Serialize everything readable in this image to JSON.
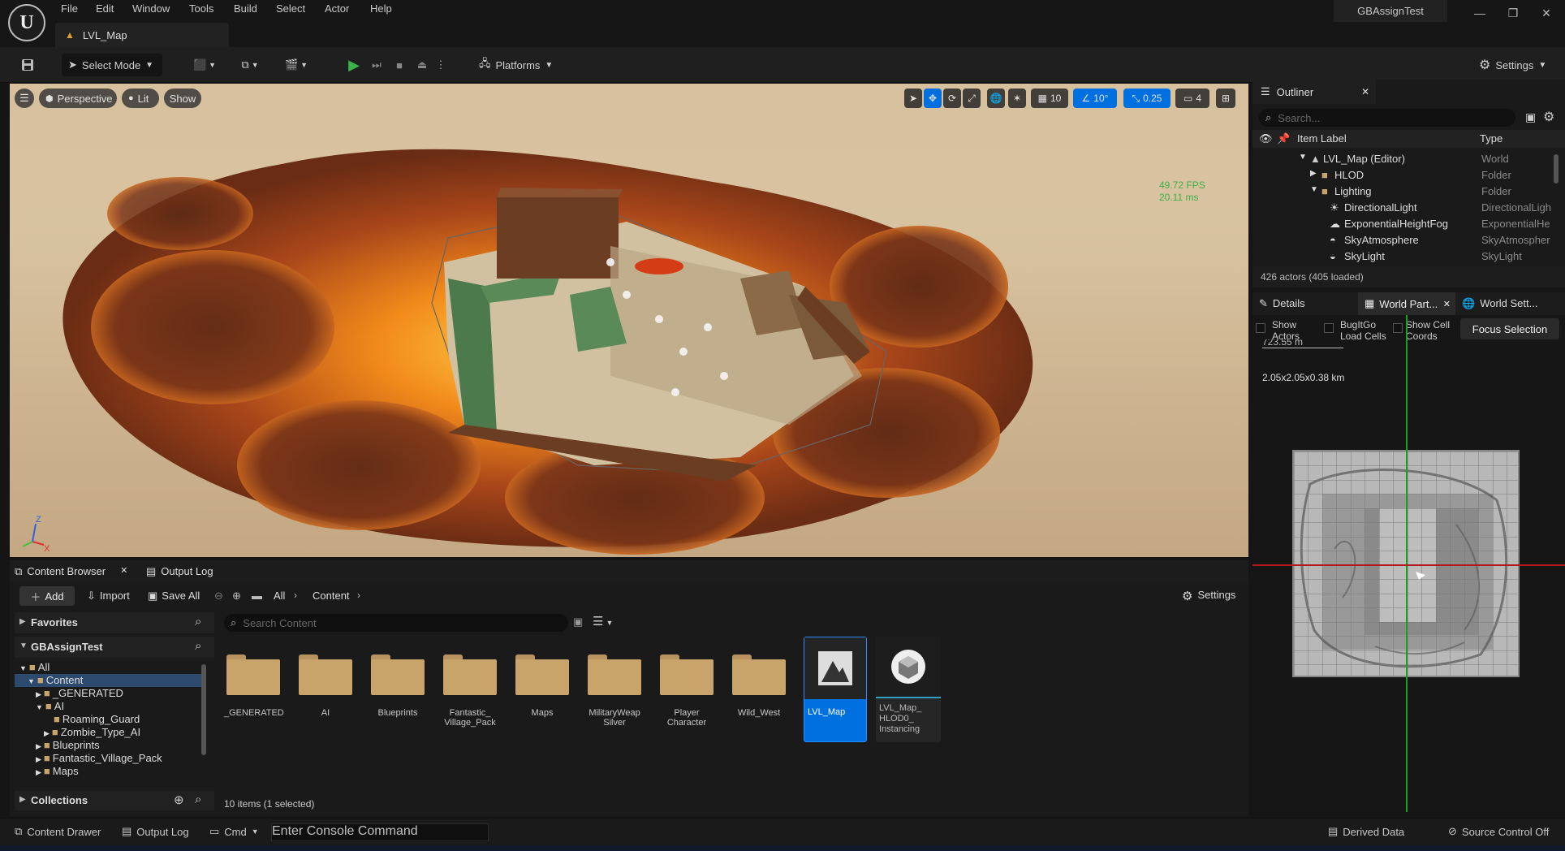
{
  "app": {
    "project_name": "GBAssignTest",
    "document_tab": "LVL_Map"
  },
  "menu": [
    "File",
    "Edit",
    "Window",
    "Tools",
    "Build",
    "Select",
    "Actor",
    "Help"
  ],
  "toolbar": {
    "select_mode": "Select Mode",
    "platforms": "Platforms",
    "settings": "Settings"
  },
  "viewport": {
    "perspective": "Perspective",
    "lit": "Lit",
    "show": "Show",
    "grid_snap": "10",
    "rotation_snap": "10°",
    "scale_snap": "0.25",
    "camera_speed": "4",
    "fps": "49.72 FPS",
    "frame_time": "20.11 ms",
    "axis_x": "X",
    "axis_z": "Z"
  },
  "outliner": {
    "title": "Outliner",
    "search_placeholder": "Search...",
    "col_label": "Item Label",
    "col_type": "Type",
    "rows": [
      {
        "label": "LVL_Map (Editor)",
        "type": "World"
      },
      {
        "label": "HLOD",
        "type": "Folder"
      },
      {
        "label": "Lighting",
        "type": "Folder"
      },
      {
        "label": "DirectionalLight",
        "type": "DirectionalLigh"
      },
      {
        "label": "ExponentialHeightFog",
        "type": "ExponentialHe"
      },
      {
        "label": "SkyAtmosphere",
        "type": "SkyAtmospher"
      },
      {
        "label": "SkyLight",
        "type": "SkyLight"
      }
    ],
    "actor_count": "426 actors (405 loaded)"
  },
  "details": {
    "tabs": [
      "Details",
      "World Part...",
      "World Sett..."
    ],
    "show_actors": "Show Actors",
    "bugitgo": "BugItGo Load Cells",
    "show_cell_coords": "Show Cell Coords",
    "focus_selection": "Focus Selection",
    "scale_label": "723.55 m",
    "world_size": "2.05x2.05x0.38 km"
  },
  "content_browser": {
    "tab": "Content Browser",
    "output_log_tab": "Output Log",
    "add": "Add",
    "import": "Import",
    "save_all": "Save All",
    "breadcrumb": [
      "All",
      "Content"
    ],
    "settings": "Settings",
    "favorites": "Favorites",
    "project_section": "GBAssignTest",
    "collections": "Collections",
    "search_placeholder": "Search Content",
    "tree": [
      "All",
      "Content",
      "_GENERATED",
      "AI",
      "Roaming_Guard",
      "Zombie_Type_AI",
      "Blueprints",
      "Fantastic_Village_Pack",
      "Maps"
    ],
    "assets": [
      {
        "name": "_GENERATED",
        "kind": "folder"
      },
      {
        "name": "AI",
        "kind": "folder"
      },
      {
        "name": "Blueprints",
        "kind": "folder"
      },
      {
        "name": "Fantastic_ Village_Pack",
        "kind": "folder"
      },
      {
        "name": "Maps",
        "kind": "folder"
      },
      {
        "name": "MilitaryWeap Silver",
        "kind": "folder"
      },
      {
        "name": "Player Character",
        "kind": "folder"
      },
      {
        "name": "Wild_West",
        "kind": "folder"
      },
      {
        "name": "LVL_Map",
        "kind": "level"
      },
      {
        "name": "LVL_Map_ HLOD0_ Instancing",
        "kind": "hlod"
      }
    ],
    "item_count": "10 items (1 selected)"
  },
  "statusbar": {
    "content_drawer": "Content Drawer",
    "output_log": "Output Log",
    "cmd": "Cmd",
    "console_placeholder": "Enter Console Command",
    "derived_data": "Derived Data",
    "source_control": "Source Control Off"
  },
  "colors": {
    "accent": "#0070e0",
    "play_green": "#3bb54a",
    "folder": "#c8a46a"
  }
}
